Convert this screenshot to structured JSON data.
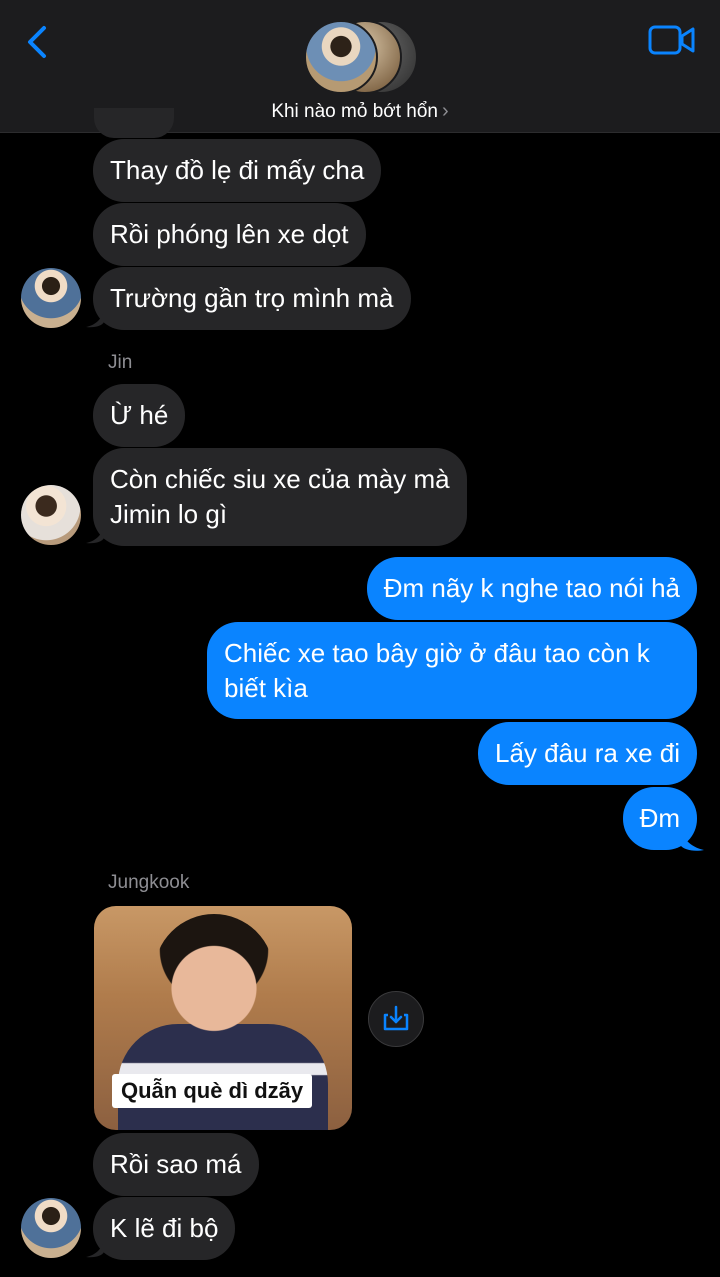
{
  "header": {
    "group_name": "Khi nào mỏ bớt hổn",
    "chevron": "›"
  },
  "icons": {
    "back": "back-chevron-icon",
    "video": "video-call-icon",
    "save": "download-icon"
  },
  "colors": {
    "outgoing_bubble": "#0a84ff",
    "incoming_bubble": "#262628",
    "header_bg": "#1c1c1e",
    "accent": "#0a84ff"
  },
  "messages": {
    "m1": "Thay đồ lẹ đi mấy cha",
    "m2": "Rồi phóng lên xe dọt",
    "m3": "Trường gần trọ mình mà",
    "sender_jin": "Jin",
    "m4": "Ừ hé",
    "m5_line1": "Còn chiếc siu xe của mày mà",
    "m5_line2": "Jimin lo gì",
    "o1": "Đm nãy k nghe tao nói hả",
    "o2_line1": "Chiếc xe tao bây giờ ở đâu tao còn k",
    "o2_line2": "biết kìa",
    "o3": "Lấy đâu ra xe đi",
    "o4": "Đm",
    "sender_jungkook": "Jungkook",
    "image_caption": "Quẫn què dì dzãy",
    "m6": "Rồi sao má",
    "m7": "K lẽ đi bộ"
  }
}
